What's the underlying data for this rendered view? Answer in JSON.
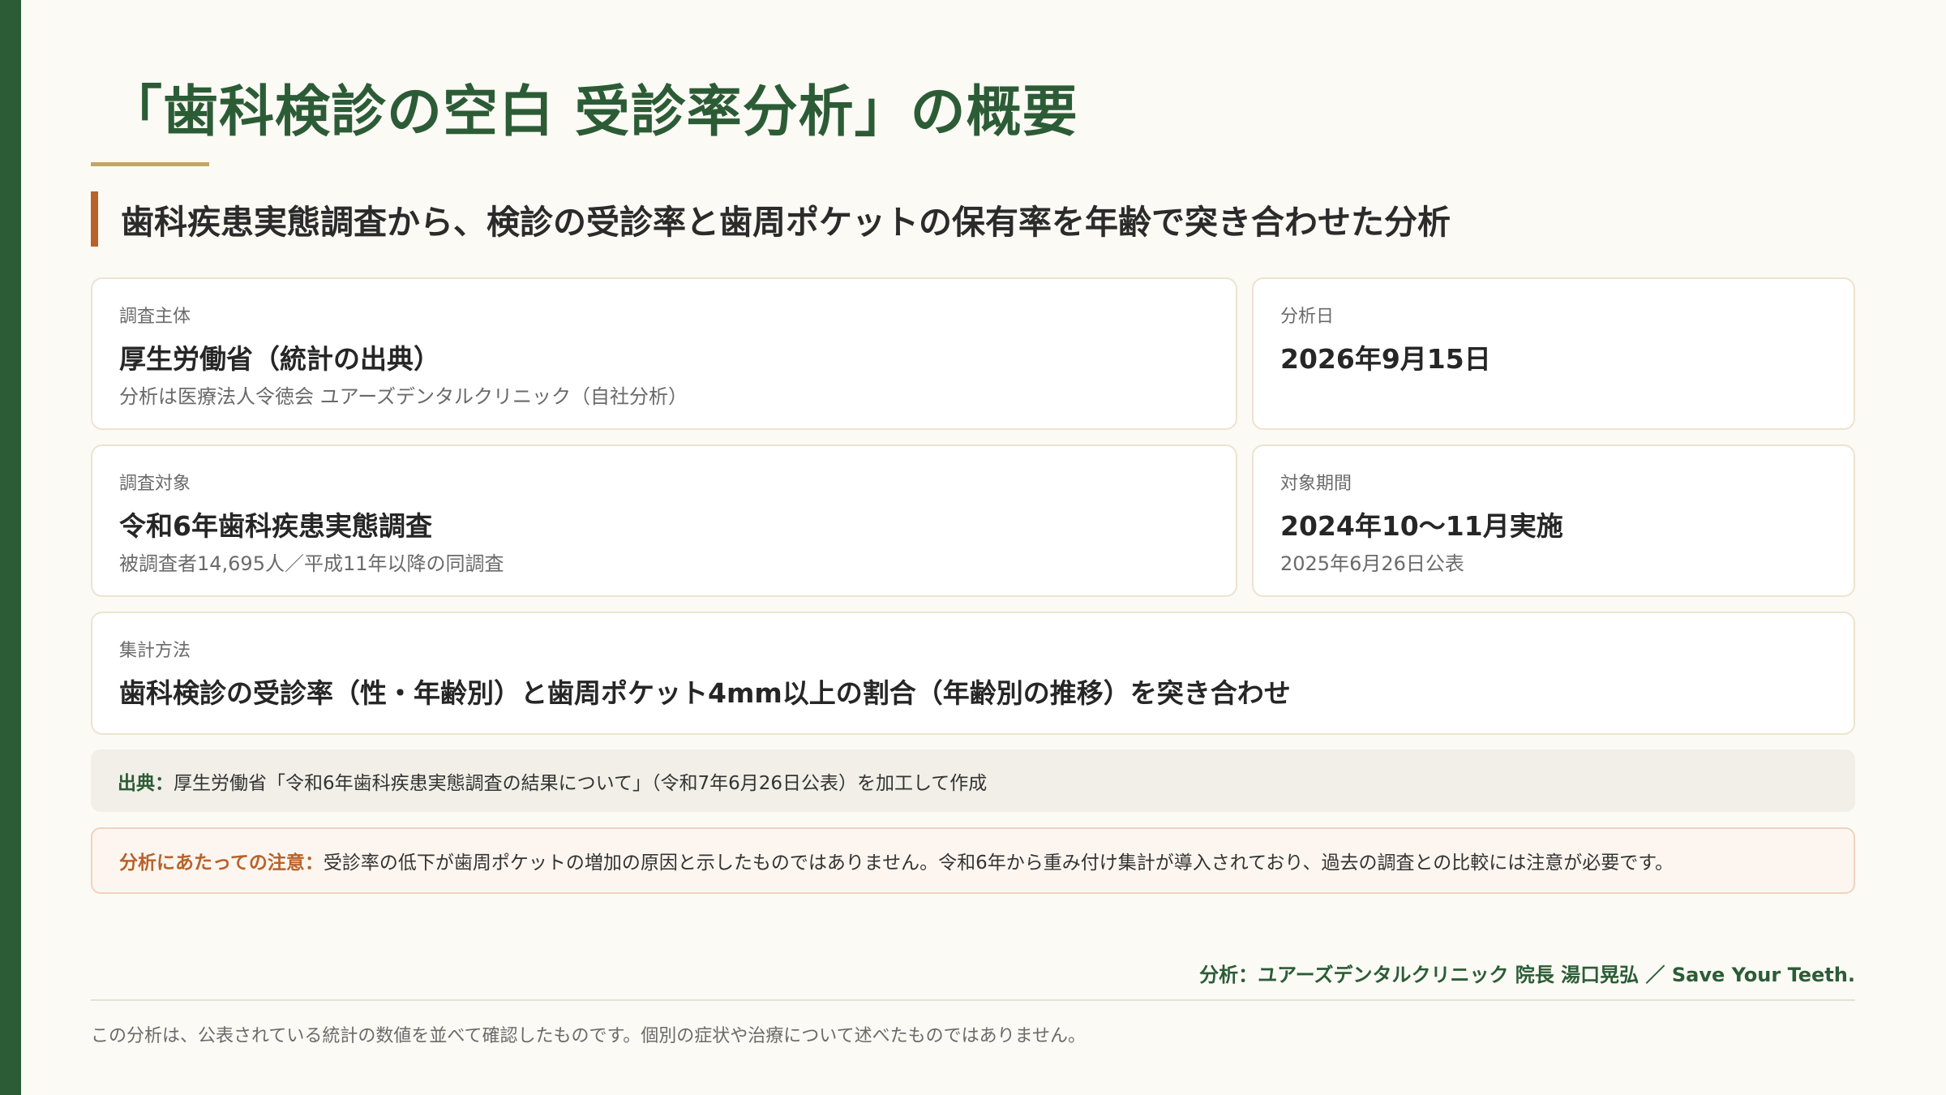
{
  "title": "「歯科検診の空白 受診率分析」の概要",
  "subtitle": "歯科疾患実態調査から、検診の受診率と歯周ポケットの保有率を年齢で突き合わせた分析",
  "cards": {
    "surveyor": {
      "label": "調査主体",
      "value": "厚生労働省（統計の出典）",
      "note": "分析は医療法人令徳会 ユアーズデンタルクリニック（自社分析）"
    },
    "analysis_date": {
      "label": "分析日",
      "value": "2026年9月15日"
    },
    "survey_target": {
      "label": "調査対象",
      "value": "令和6年歯科疾患実態調査",
      "note": "被調査者14,695人／平成11年以降の同調査"
    },
    "period": {
      "label": "対象期間",
      "value": "2024年10〜11月実施",
      "note": "2025年6月26日公表"
    },
    "method": {
      "label": "集計方法",
      "value": "歯科検診の受診率（性・年齢別）と歯周ポケット4mm以上の割合（年齢別の推移）を突き合わせ"
    }
  },
  "source": {
    "key": "出典：",
    "text": "厚生労働省「令和6年歯科疾患実態調査の結果について」（令和7年6月26日公表）を加工して作成"
  },
  "caution": {
    "key": "分析にあたっての注意：",
    "text": "受診率の低下が歯周ポケットの増加の原因と示したものではありません。令和6年から重み付け集計が導入されており、過去の調査との比較には注意が必要です。"
  },
  "credit": "分析：ユアーズデンタルクリニック 院長 湯口晃弘 ／ Save Your Teeth.",
  "footer_note": "この分析は、公表されている統計の数値を並べて確認したものです。個別の症状や治療について述べたものではありません。",
  "colors": {
    "brand_green": "#2c5c36",
    "accent_orange": "#b8622b",
    "gold": "#c2a765"
  }
}
